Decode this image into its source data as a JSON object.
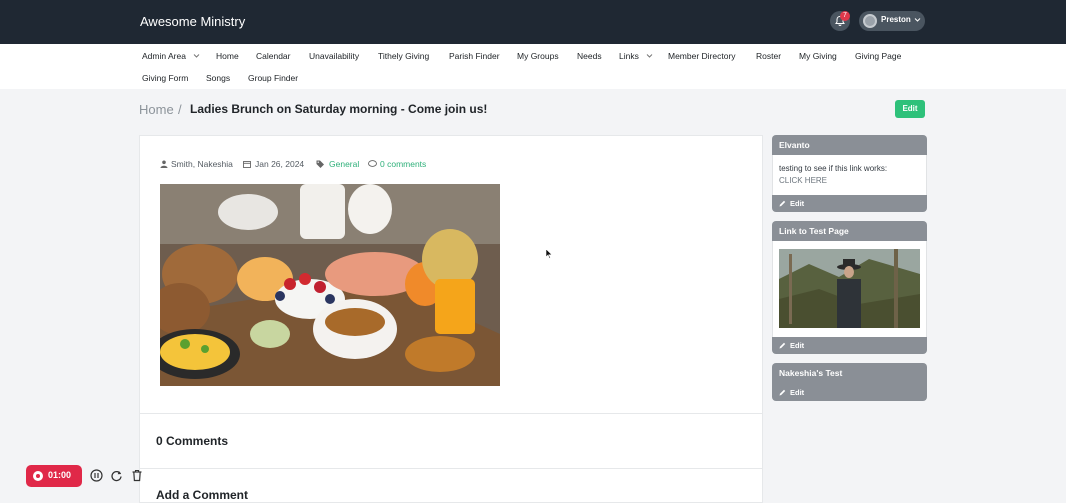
{
  "header": {
    "brand": "Awesome Ministry",
    "notification_count": "7",
    "user_name": "Preston"
  },
  "nav": {
    "items": [
      {
        "label": "Admin Area",
        "has_dropdown": true
      },
      {
        "label": "Home"
      },
      {
        "label": "Calendar"
      },
      {
        "label": "Unavailability"
      },
      {
        "label": "Tithely Giving"
      },
      {
        "label": "Parish Finder"
      },
      {
        "label": "My Groups"
      },
      {
        "label": "Needs"
      },
      {
        "label": "Links",
        "has_dropdown": true
      },
      {
        "label": "Member Directory"
      },
      {
        "label": "Roster"
      },
      {
        "label": "My Giving"
      },
      {
        "label": "Giving Page"
      },
      {
        "label": "Giving Form"
      },
      {
        "label": "Songs"
      },
      {
        "label": "Group Finder"
      }
    ]
  },
  "breadcrumb": {
    "home": "Home",
    "separator": "/",
    "current": "Ladies Brunch on Saturday morning - Come join us!"
  },
  "page": {
    "edit_label": "Edit"
  },
  "post": {
    "author": "Smith, Nakeshia",
    "date": "Jan 26, 2024",
    "category": "General",
    "comments_link": "0 comments",
    "image_alt": "Breakfast spread with fruit, bread, tea and juice"
  },
  "comments": {
    "title": "0 Comments",
    "add_title": "Add a Comment"
  },
  "sidebar": {
    "widgets": [
      {
        "title": "Elvanto",
        "text": "testing to see if this link works:",
        "link": "CLICK HERE",
        "footer": "Edit"
      },
      {
        "title": "Link to Test Page",
        "footer": "Edit"
      },
      {
        "title": "Nakeshia's Test",
        "footer": "Edit"
      }
    ]
  },
  "recorder": {
    "time": "01:00"
  },
  "colors": {
    "topbar": "#1f2833",
    "accent_green": "#2ec17a",
    "link_green": "#2fb07a",
    "widget_gray": "#8a8f96",
    "record_red": "#e02848"
  }
}
